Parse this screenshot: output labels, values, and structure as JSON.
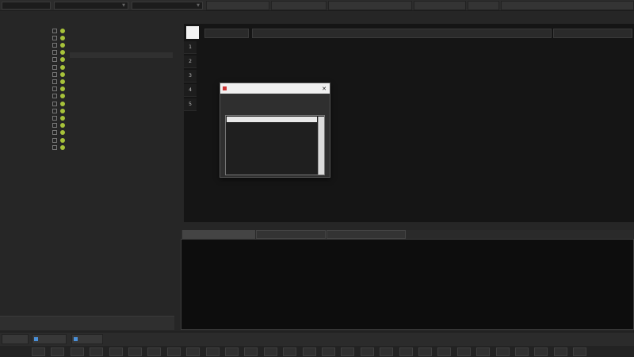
{
  "toolbar": {
    "combo_1": "",
    "combo_2": "",
    "combo_3": "",
    "btn_1": "",
    "btn_2": "",
    "btn_3": "",
    "btn_4": "",
    "btn_5": "",
    "btn_6": ""
  },
  "left_panel": {
    "header": "",
    "rows": [
      "",
      "",
      "",
      "",
      "",
      "",
      "",
      "",
      "",
      "",
      "",
      "",
      "",
      "",
      "",
      "",
      ""
    ],
    "bottom_button": ""
  },
  "path_bar": "",
  "table": {
    "columns": [
      "",
      "",
      ""
    ],
    "rows": [
      {
        "num": "1",
        "c1": "",
        "c2": "",
        "c3": ""
      },
      {
        "num": "2",
        "c1": "",
        "c2": "",
        "c3": ""
      },
      {
        "num": "3",
        "c1": "",
        "c2": "",
        "c3": ""
      },
      {
        "num": "4",
        "c1": "",
        "c2": "",
        "c3": ""
      },
      {
        "num": "5",
        "c1": "",
        "c2": "",
        "c3": ""
      }
    ]
  },
  "dialog": {
    "title": "",
    "prompt": "",
    "items": [
      "",
      "",
      "",
      "",
      "",
      "",
      "",
      "",
      "",
      "",
      ""
    ]
  },
  "console": {
    "tabs": [
      "",
      "",
      ""
    ],
    "lines": [
      "",
      "",
      "",
      "",
      ""
    ]
  },
  "status_bar": {
    "btn_1": "",
    "btn_2": "",
    "btn_3": ""
  },
  "bottom_cells": [
    "",
    "",
    "",
    "",
    "",
    "",
    "",
    "",
    "",
    "",
    "",
    "",
    "",
    "",
    "",
    "",
    "",
    "",
    "",
    "",
    "",
    "",
    "",
    "",
    "",
    "",
    "",
    "",
    ""
  ]
}
